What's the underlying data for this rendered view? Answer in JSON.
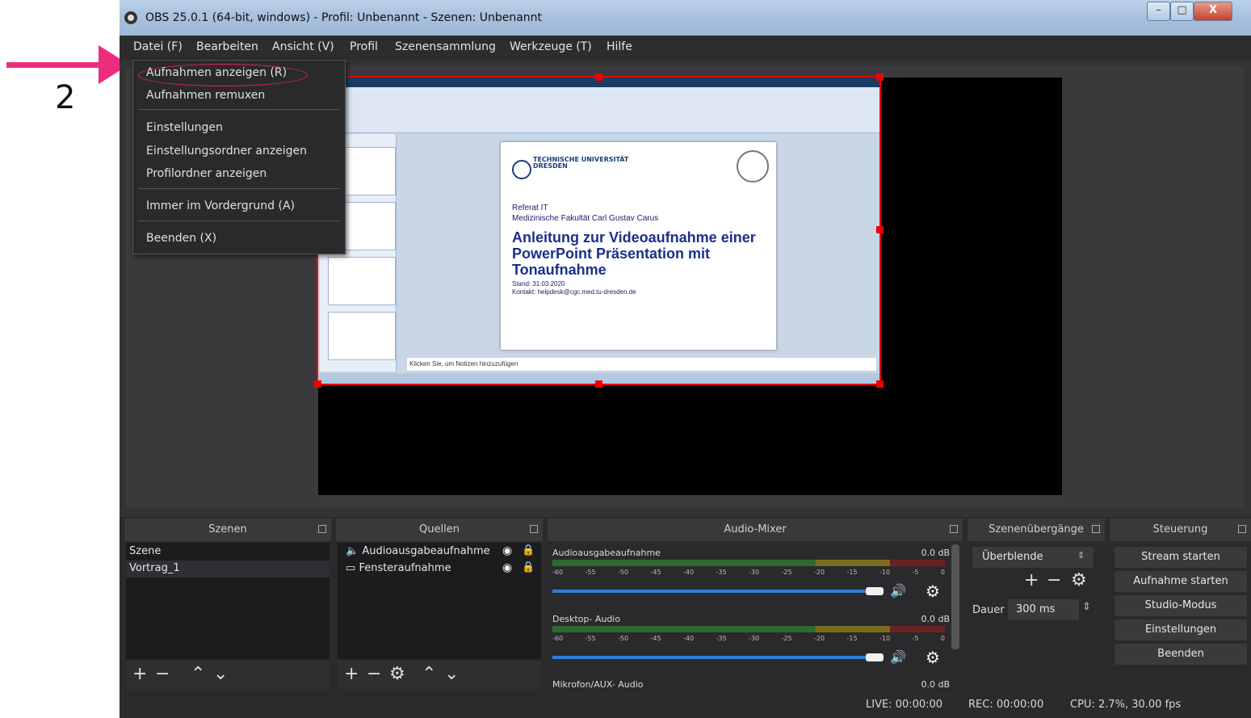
{
  "annotation": {
    "step_number": "2"
  },
  "window": {
    "title": "OBS 25.0.1 (64-bit, windows) - Profil: Unbenannt - Szenen: Unbenannt",
    "min": "–",
    "max": "□",
    "close": "X"
  },
  "menubar": [
    "Datei (F)",
    "Bearbeiten",
    "Ansicht (V)",
    "Profil",
    "Szenensammlung",
    "Werkzeuge (T)",
    "Hilfe"
  ],
  "file_menu": {
    "items": [
      "Aufnahmen anzeigen (R)",
      "Aufnahmen remuxen",
      "Einstellungen",
      "Einstellungsordner anzeigen",
      "Profilordner anzeigen",
      "Immer im Vordergrund (A)",
      "Beenden (X)"
    ],
    "highlighted": "Aufnahmen anzeigen (R)"
  },
  "preview": {
    "slide": {
      "university": "TECHNISCHE UNIVERSITÄT DRESDEN",
      "referat": "Referat IT",
      "faculty": "Medizinische  Fakultät  Carl Gustav  Carus",
      "heading": "Anleitung zur Videoaufnahme einer PowerPoint Präsentation mit Tonaufnahme",
      "stand": "Stand: 31.03.2020",
      "kontakt": "Kontakt: helpdesk@cgc.med.tu-dresden.de"
    },
    "notes": "Klicken Sie, um Notizen hinzuzufügen"
  },
  "docks": {
    "scenes": {
      "title": "Szenen",
      "items": [
        "Szene",
        "Vortrag_1"
      ]
    },
    "sources": {
      "title": "Quellen",
      "items": [
        "Audioausgabeaufnahme",
        "Fensteraufnahme"
      ]
    },
    "mixer": {
      "title": "Audio-Mixer",
      "scale": [
        "-60",
        "-55",
        "-50",
        "-45",
        "-40",
        "-35",
        "-30",
        "-25",
        "-20",
        "-15",
        "-10",
        "-5",
        "0"
      ],
      "channels": [
        {
          "name": "Audioausgabeaufnahme",
          "db": "0.0 dB"
        },
        {
          "name": "Desktop- Audio",
          "db": "0.0 dB"
        },
        {
          "name": "Mikrofon/AUX- Audio",
          "db": "0.0 dB"
        }
      ]
    },
    "transitions": {
      "title": "Szenenübergänge",
      "selected": "Überblende",
      "duration_label": "Dauer",
      "duration_value": "300 ms"
    },
    "controls": {
      "title": "Steuerung",
      "buttons": [
        "Stream starten",
        "Aufnahme starten",
        "Studio-Modus",
        "Einstellungen",
        "Beenden"
      ]
    }
  },
  "statusbar": {
    "live": "LIVE: 00:00:00",
    "rec": "REC: 00:00:00",
    "cpu": "CPU: 2.7%, 30.00 fps"
  },
  "colors": {
    "arrow": "#ec2d7e",
    "selection": "#ee0000",
    "accent": "#2a7fd4"
  }
}
